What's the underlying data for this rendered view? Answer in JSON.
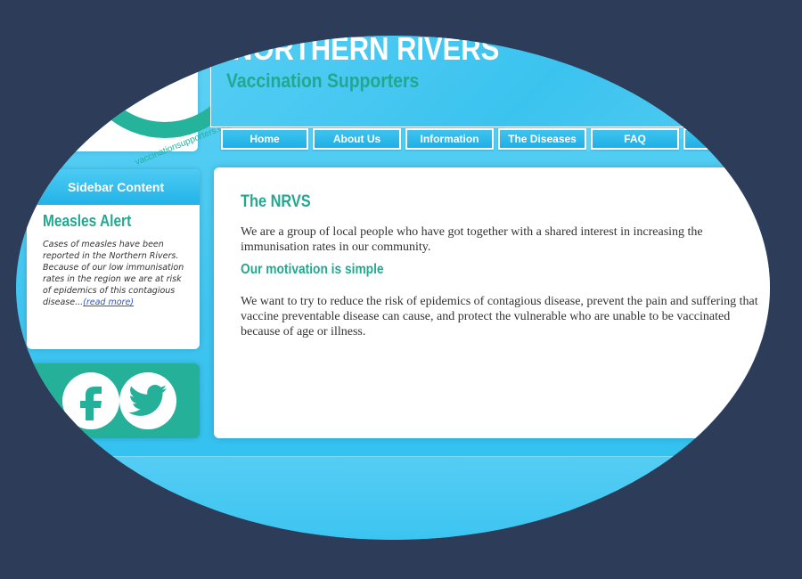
{
  "header": {
    "title": "NORTHERN RIVERS",
    "subtitle": "Vaccination Supporters"
  },
  "logo": {
    "url_text": "vaccinationsupporters.org"
  },
  "nav": {
    "items": [
      {
        "label": "Home"
      },
      {
        "label": "About Us"
      },
      {
        "label": "Information"
      },
      {
        "label": "The Diseases"
      },
      {
        "label": "FAQ"
      }
    ]
  },
  "sidebar": {
    "heading": "Sidebar Content",
    "alert_title": "Measles Alert",
    "alert_text": "Cases of measles have been reported in the Northern Rivers. Because of our low immunisation rates in the region we are at risk of epidemics of this contagious disease...",
    "read_more": "(read more)"
  },
  "social": {
    "icons": [
      "facebook-icon",
      "twitter-icon"
    ]
  },
  "main": {
    "heading": "The NRVS",
    "intro": "We are a group of local people who have got together with a shared interest in increasing the immunisation rates in our community.",
    "subheading": "Our motivation is simple",
    "body": "We want to try to reduce the risk of epidemics of contagious disease, prevent the pain and suffering that vaccine preventable disease can cause, and protect the vulnerable who are unable to be vaccinated because of age or illness."
  },
  "colors": {
    "frame": "#2d3c58",
    "sky": "#3fc4ef",
    "teal": "#23a88f",
    "link": "#2b56c9"
  }
}
